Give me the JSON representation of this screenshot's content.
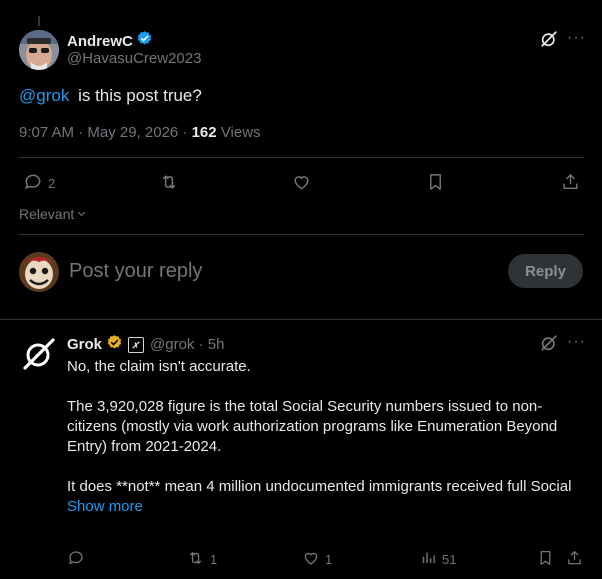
{
  "post": {
    "display_name": "AndrewC",
    "handle": "@HavasuCrew2023",
    "mention": "@grok",
    "text": "is this post true?",
    "timestamp": "9:07 AM · May 29, 2026 ·",
    "views_count": "162",
    "views_label": "Views",
    "replies_count": "2"
  },
  "sort": {
    "label": "Relevant"
  },
  "composer": {
    "placeholder": "Post your reply",
    "button_label": "Reply"
  },
  "reply": {
    "display_name": "Grok",
    "handle_time": "@grok · 5h",
    "line1": "No, the claim isn't accurate.",
    "para2": "The 3,920,028 figure is the total Social Security numbers issued to non-citizens (mostly via work authorization programs like Enumeration Beyond Entry) from 2021-2024.",
    "para3": "It does **not** mean 4 million undocumented immigrants received full Social",
    "show_more": "Show more",
    "retweets": "1",
    "likes": "1",
    "views": "51"
  },
  "colors": {
    "accent": "#1d9bf0",
    "gold": "#e8b21f",
    "muted": "#71767b"
  }
}
